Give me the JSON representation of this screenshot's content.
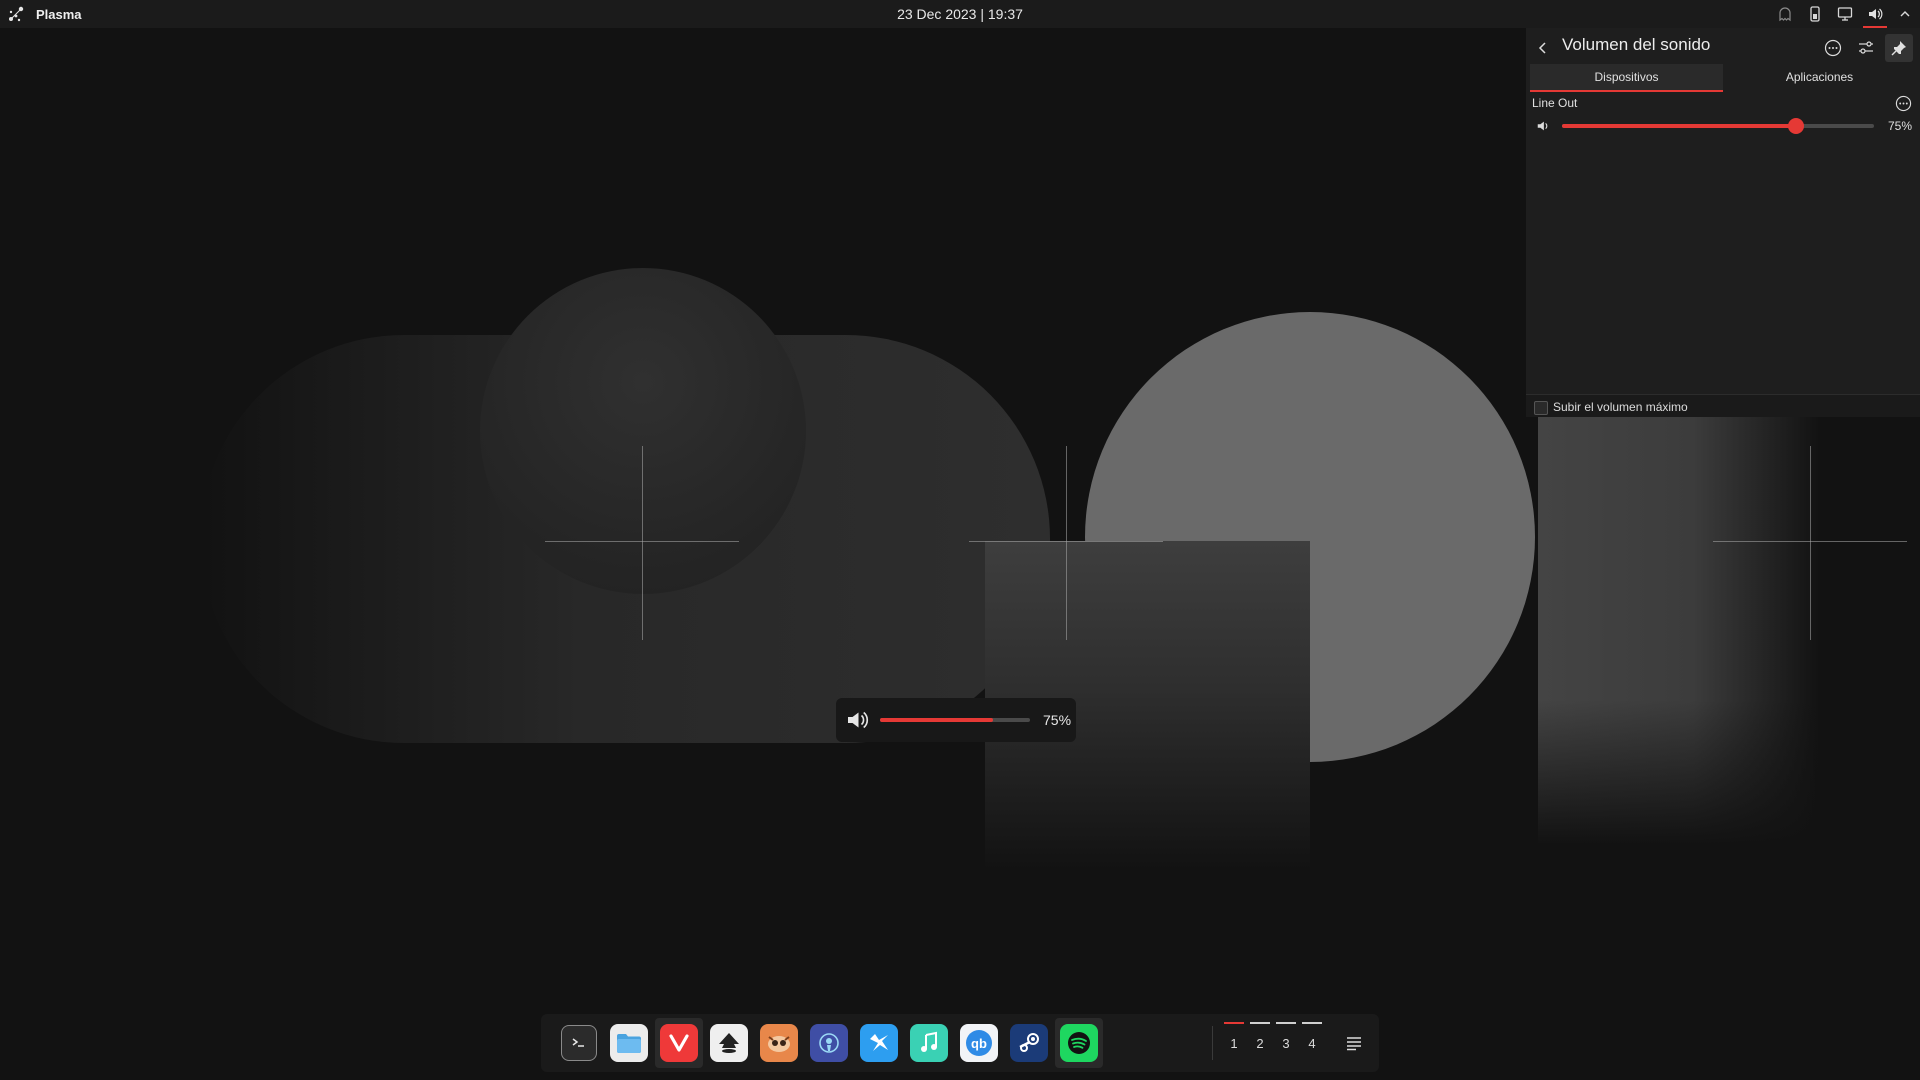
{
  "topbar": {
    "launcher_label": "Plasma",
    "clock": "23 Dec 2023 | 19:37",
    "tray_icons": [
      "ghost-icon",
      "battery-phone-icon",
      "display-icon",
      "volume-icon",
      "chevron-up-icon"
    ]
  },
  "volume_panel": {
    "title": "Volumen del sonido",
    "tabs": [
      {
        "label": "Dispositivos",
        "active": true
      },
      {
        "label": "Aplicaciones",
        "active": false
      }
    ],
    "device": {
      "name": "Line Out",
      "volume_percent": 75,
      "volume_label": "75%"
    },
    "raise_max_volume_label": "Subir el volumen máximo",
    "raise_max_volume_checked": false
  },
  "osd": {
    "volume_percent": 75,
    "volume_label": "75%"
  },
  "dock": {
    "apps": [
      {
        "name": "terminal",
        "icon": "terminal-icon"
      },
      {
        "name": "files",
        "icon": "folder-icon"
      },
      {
        "name": "vivaldi",
        "icon": "vivaldi-icon"
      },
      {
        "name": "inkscape",
        "icon": "inkscape-icon"
      },
      {
        "name": "bottles",
        "icon": "fox-icon"
      },
      {
        "name": "mission-center",
        "icon": "podcast-icon"
      },
      {
        "name": "fast-launcher",
        "icon": "bird-icon"
      },
      {
        "name": "music",
        "icon": "music-icon"
      },
      {
        "name": "qbittorrent",
        "icon": "qbittorrent-icon"
      },
      {
        "name": "steam",
        "icon": "steam-icon"
      },
      {
        "name": "spotify",
        "icon": "spotify-icon"
      }
    ],
    "desktops": [
      "1",
      "2",
      "3",
      "4"
    ],
    "current_desktop": "1"
  },
  "colors": {
    "accent": "#e53935",
    "background": "#121212",
    "panel": "#1e1e1e"
  }
}
